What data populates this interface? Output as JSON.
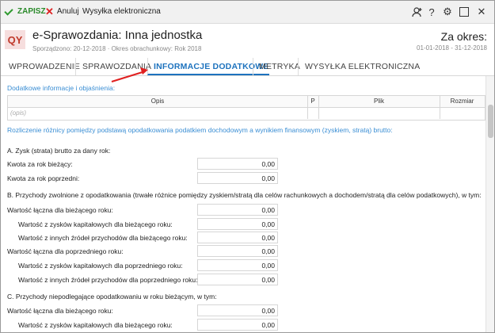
{
  "toolbar": {
    "save_label": "ZAPISZ",
    "cancel_label": "Anuluj",
    "send_label": "Wysyłka elektroniczna"
  },
  "header": {
    "logo_text": "QY",
    "title": "e-Sprawozdania: Inna jednostka",
    "subtitle": "Sporządzono: 20-12-2018 · Okres obrachunkowy: Rok 2018",
    "period_label": "Za okres:",
    "period_range": "01-01-2018 - 31-12-2018"
  },
  "tabs": [
    {
      "label": "WPROWADZENIE"
    },
    {
      "label": "SPRAWOZDANIA"
    },
    {
      "label": "INFORMACJE DODATKOWE"
    },
    {
      "label": "METRYKA"
    },
    {
      "label": "WYSYŁKA ELEKTRONICZNA"
    }
  ],
  "section1": {
    "title": "Dodatkowe informacje i objaśnienia:",
    "columns": [
      "Opis",
      "P",
      "Plik",
      "Rozmiar"
    ],
    "placeholder": "(opis)"
  },
  "section2": {
    "title": "Rozliczenie różnicy pomiędzy podstawą opodatkowania podatkiem dochodowym a wynikiem finansowym (zyskiem, stratą) brutto:"
  },
  "rows": [
    {
      "label": "A. Zysk (strata) brutto za dany rok:"
    },
    {
      "label": "Kwota za rok bieżący:",
      "value": "0,00"
    },
    {
      "label": "Kwota za rok poprzedni:",
      "value": "0,00"
    },
    {
      "label": "B. Przychody zwolnione z opodatkowania (trwałe różnice pomiędzy zyskiem/stratą dla celów rachunkowych a dochodem/stratą dla celów podatkowych), w tym:"
    },
    {
      "label": "Wartość łączna dla bieżącego roku:",
      "value": "0,00"
    },
    {
      "label": "Wartość z zysków kapitałowych dla bieżącego roku:",
      "value": "0,00"
    },
    {
      "label": "Wartość z innych źródeł przychodów dla bieżącego roku:",
      "value": "0,00"
    },
    {
      "label": "Wartość łączna dla poprzedniego roku:",
      "value": "0,00"
    },
    {
      "label": "Wartość z zysków kapitałowych dla poprzedniego roku:",
      "value": "0,00"
    },
    {
      "label": "Wartość z innych źródeł przychodów dla poprzedniego roku:",
      "value": "0,00"
    },
    {
      "label": "C. Przychody niepodlegające opodatkowaniu w roku bieżącym, w tym:"
    },
    {
      "label": "Wartość łączna dla bieżącego roku:",
      "value": "0,00"
    },
    {
      "label": "Wartość z zysków kapitałowych dla bieżącego roku:",
      "value": "0,00"
    }
  ],
  "colors": {
    "accent": "#1e73be",
    "save": "#2a8a2a",
    "cancel": "#d22222",
    "logo_bg": "#f6dede",
    "logo_fg": "#c0392b",
    "arrow": "#e02020"
  }
}
